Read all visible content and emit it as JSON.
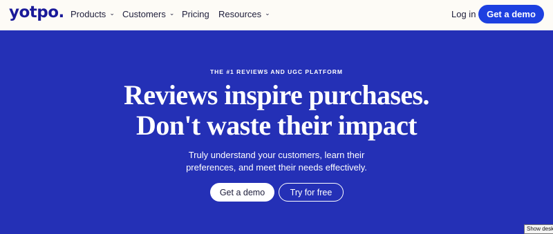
{
  "nav": {
    "logo": "yotpo.",
    "items": [
      {
        "label": "Products",
        "dropdown": true
      },
      {
        "label": "Customers",
        "dropdown": true
      },
      {
        "label": "Pricing",
        "dropdown": false
      },
      {
        "label": "Resources",
        "dropdown": true
      }
    ],
    "login_label": "Log in",
    "demo_label": "Get a demo"
  },
  "hero": {
    "eyebrow": "THE #1 REVIEWS AND UGC PLATFORM",
    "headline_line1": "Reviews inspire purchases.",
    "headline_line2": "Don't waste their impact",
    "subtext": "Truly understand your customers, learn their preferences, and meet their needs effectively.",
    "primary_cta": "Get a demo",
    "secondary_cta": "Try for free"
  },
  "tooltip": "Show desk",
  "colors": {
    "hero_bg": "#2430b6",
    "nav_bg": "#fdfbf6",
    "brand": "#1a1a99",
    "cta_blue": "#1d40e0"
  },
  "icons": {
    "dropdown": "chevron-down-icon"
  }
}
